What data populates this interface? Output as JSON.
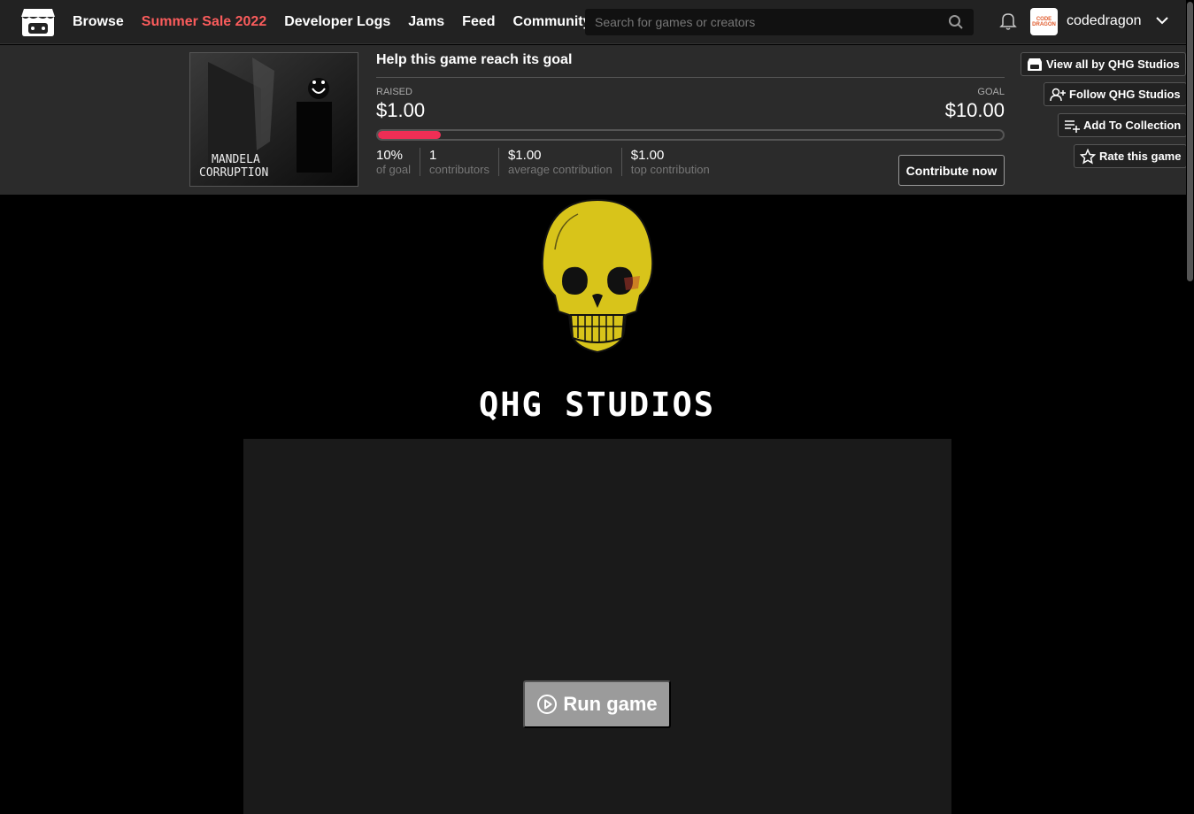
{
  "nav": {
    "items": [
      "Browse",
      "Summer Sale 2022",
      "Developer Logs",
      "Jams",
      "Feed",
      "Community"
    ]
  },
  "search": {
    "placeholder": "Search for games or creators"
  },
  "user": {
    "name": "codedragon",
    "avatar_text": "CODE DRAGON"
  },
  "cover": {
    "line1": "MANDELA",
    "line2": "CORRUPTION"
  },
  "goal": {
    "heading": "Help this game reach its goal",
    "raised_label": "RAISED",
    "raised": "$1.00",
    "goal_label": "GOAL",
    "goal": "$10.00",
    "progress_fraction": 0.1,
    "stats": [
      {
        "value": "10%",
        "desc": "of goal"
      },
      {
        "value": "1",
        "desc": "contributors"
      },
      {
        "value": "$1.00",
        "desc": "average contribution"
      },
      {
        "value": "$1.00",
        "desc": "top contribution"
      }
    ],
    "contribute_label": "Contribute now"
  },
  "side_buttons": {
    "view_all": "View all by QHG Studios",
    "follow": "Follow QHG Studios",
    "add_collection": "Add To Collection",
    "rate": "Rate this game"
  },
  "studio_name": "QHG STUDIOS",
  "run_label": "Run game",
  "colors": {
    "accent": "#fa5c5c",
    "progress": "#ee2e55",
    "skull": "#d8c41a"
  }
}
